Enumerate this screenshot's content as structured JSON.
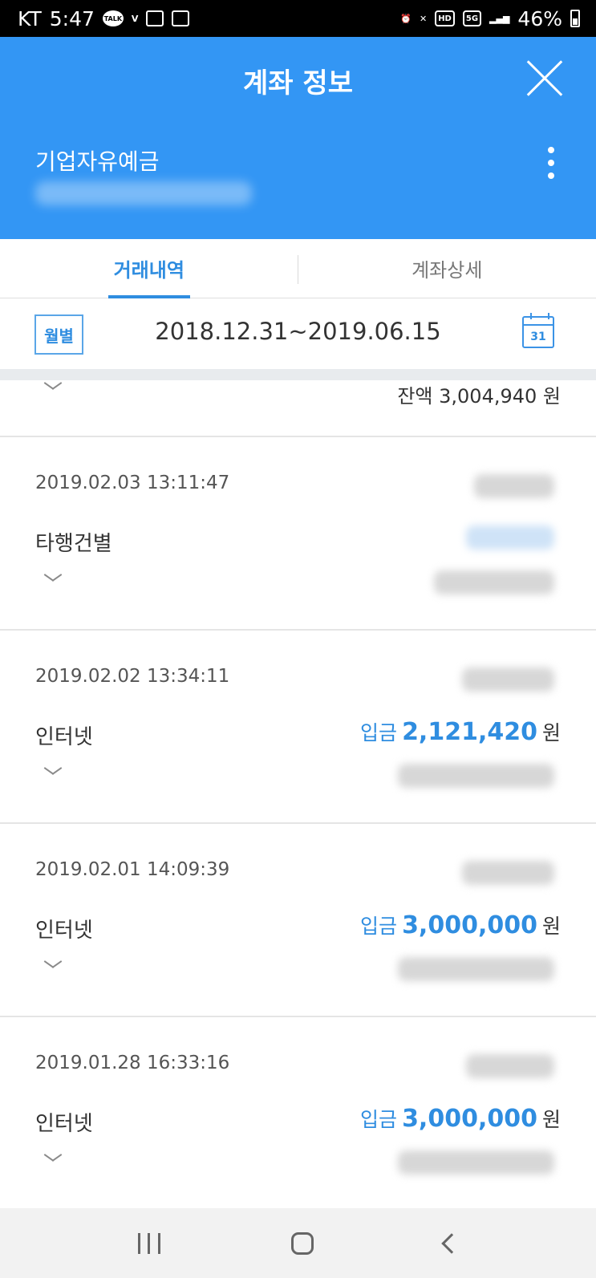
{
  "status_bar": {
    "carrier": "KT",
    "time": "5:47",
    "battery": "46%",
    "icons": [
      "kakaotalk-icon",
      "volte-icon",
      "gallery-icon",
      "calendar-icon",
      "alarm-icon",
      "mute-icon",
      "hd-icon",
      "5g-icon",
      "signal-icon",
      "battery-icon"
    ]
  },
  "header": {
    "title": "계좌 정보",
    "account_name": "기업자유예금"
  },
  "tabs": [
    {
      "label": "거래내역",
      "active": true
    },
    {
      "label": "계좌상세",
      "active": false
    }
  ],
  "filter": {
    "period_button": "월별",
    "date_range": "2018.12.31~2019.06.15",
    "calendar_day": "31"
  },
  "partial_entry": {
    "balance": "잔액 3,004,940 원"
  },
  "transactions": [
    {
      "datetime": "2019.02.03 13:11:47",
      "description": "타행건별",
      "amount_kind": "",
      "amount": "",
      "unit": ""
    },
    {
      "datetime": "2019.02.02 13:34:11",
      "description": "인터넷",
      "amount_kind": "입금",
      "amount": "2,121,420",
      "unit": "원"
    },
    {
      "datetime": "2019.02.01 14:09:39",
      "description": "인터넷",
      "amount_kind": "입금",
      "amount": "3,000,000",
      "unit": "원"
    },
    {
      "datetime": "2019.01.28 16:33:16",
      "description": "인터넷",
      "amount_kind": "입금",
      "amount": "3,000,000",
      "unit": "원"
    }
  ],
  "colors": {
    "header_bg": "#3396f4",
    "accent": "#2f8de0"
  }
}
